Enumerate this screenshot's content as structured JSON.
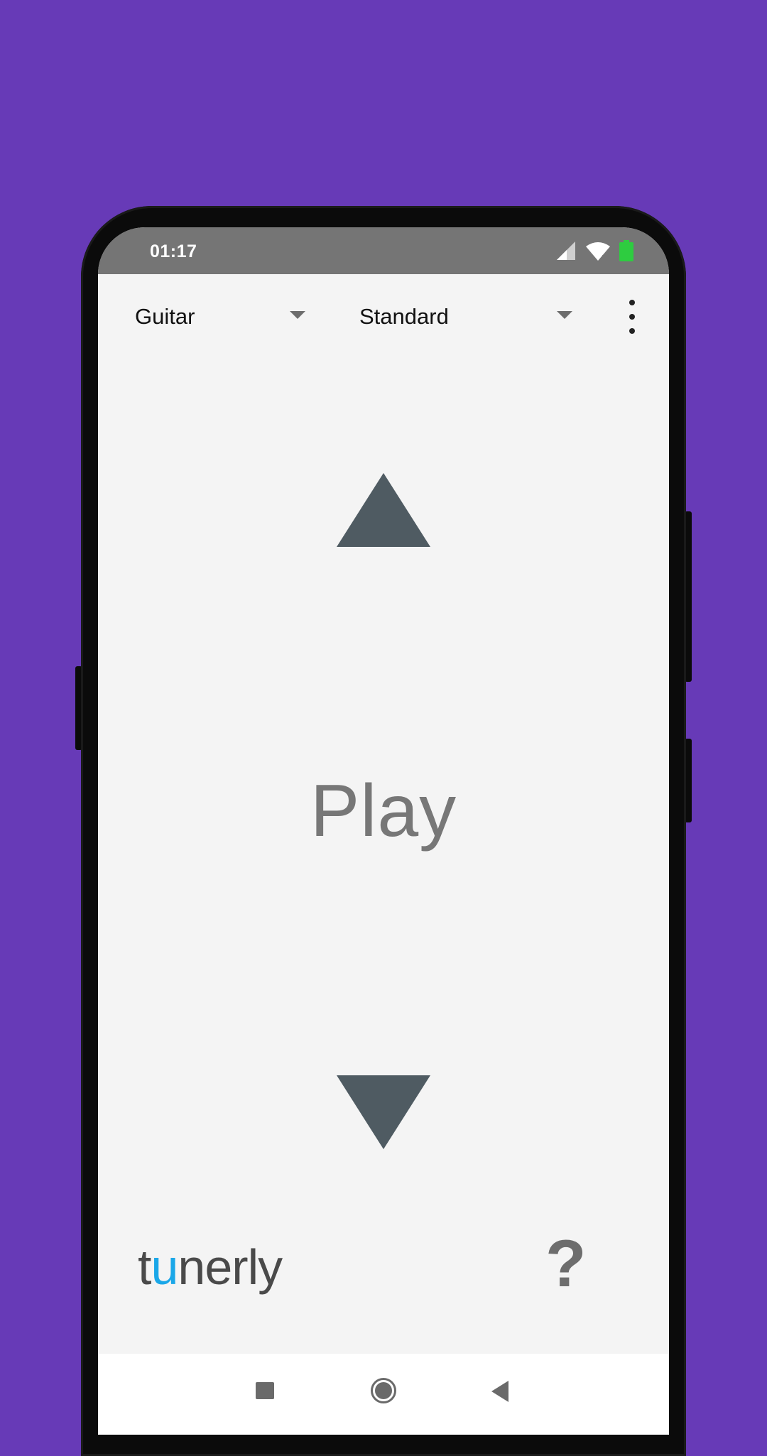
{
  "status_bar": {
    "time": "01:17",
    "icons": [
      "signal-icon",
      "wifi-icon",
      "battery-icon"
    ],
    "battery_color": "#2ecc40"
  },
  "toolbar": {
    "instrument_label": "Guitar",
    "tuning_label": "Standard",
    "overflow_icon": "more-vert-icon"
  },
  "tuner": {
    "status_text": "Play",
    "up_icon": "triangle-up-icon",
    "down_icon": "triangle-down-icon"
  },
  "footer": {
    "logo_text_prefix": "t",
    "logo_text_accent": "u",
    "logo_text_suffix": "nerly",
    "help_label": "?",
    "logo_accent_color": "#1aa7e8"
  },
  "navbar": {
    "icons": [
      "recents-icon",
      "home-icon",
      "back-icon"
    ]
  },
  "colors": {
    "background": "#673ab7",
    "screen": "#f4f4f4",
    "statusbar": "#757575",
    "arrow": "#4f5b62"
  }
}
